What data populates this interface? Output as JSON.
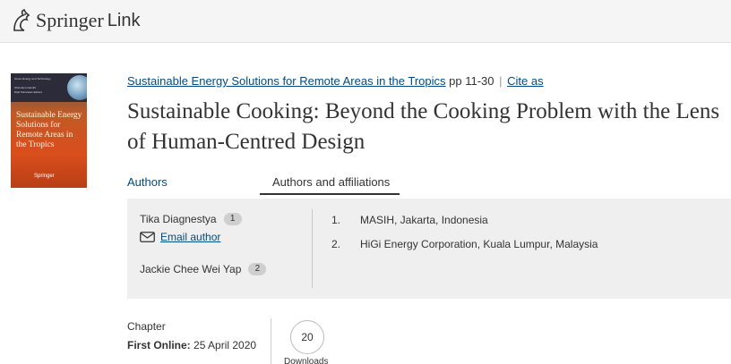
{
  "header": {
    "brand_primary": "Springer",
    "brand_secondary": "Link",
    "logo_icon": "springer-horse-icon"
  },
  "cover": {
    "series_text": "Green Energy and Technology",
    "editors_text_1": "Oktoviano Gandhi",
    "editors_text_2": "Dipti Srinivasan Editors",
    "title": "Sustainable Energy Solutions for Remote Areas in the Tropics",
    "publisher": "Springer"
  },
  "book": {
    "title": "Sustainable Energy Solutions for Remote Areas in the Tropics",
    "pages": "pp 11-30",
    "separator": "|",
    "cite_label": "Cite as"
  },
  "chapter": {
    "title": "Sustainable Cooking: Beyond the Cooking Problem with the Lens of Human-Centred Design"
  },
  "tabs": {
    "authors": "Authors",
    "affiliations": "Authors and affiliations"
  },
  "authors": [
    {
      "name": "Tika Diagnestya",
      "badge": "1"
    },
    {
      "name": "Jackie Chee Wei Yap",
      "badge": "2"
    }
  ],
  "email_author": "Email author",
  "affiliations": [
    {
      "num": "1.",
      "text": "MASIH, Jakarta, Indonesia"
    },
    {
      "num": "2.",
      "text": "HiGi Energy Corporation, Kuala Lumpur, Malaysia"
    }
  ],
  "meta": {
    "type": "Chapter",
    "first_online_label": "First Online:",
    "first_online_date": "25 April 2020",
    "downloads_count": "20",
    "downloads_label": "Downloads"
  },
  "colors": {
    "link": "#004b83",
    "header_bg": "#f5f5f5",
    "box_bg": "#efefef",
    "cover_orange": "#d94e1c"
  }
}
